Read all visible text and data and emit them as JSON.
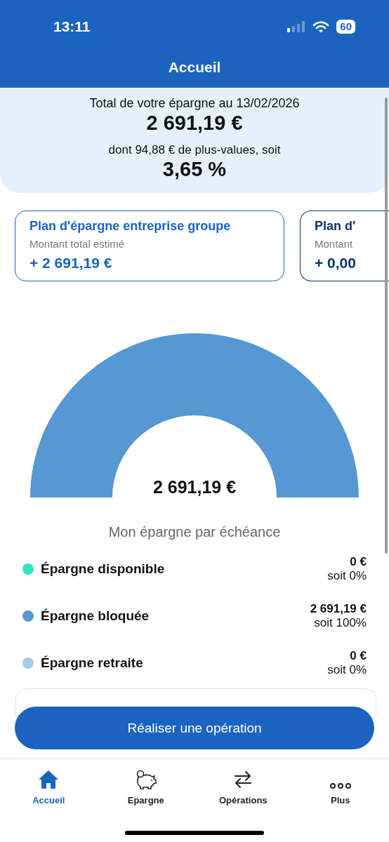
{
  "status_bar": {
    "time": "13:11",
    "battery": "60"
  },
  "header": {
    "title": "Accueil"
  },
  "summary": {
    "label": "Total de votre épargne au 13/02/2026",
    "total": "2 691,19 €",
    "gains_label": "dont 94,88 € de plus-values, soit",
    "gains_percent": "3,65 %"
  },
  "plans": [
    {
      "title": "Plan d'épargne entreprise groupe",
      "subtitle": "Montant total estimé",
      "amount": "+ 2 691,19 €",
      "clipped": false
    },
    {
      "title": "Plan d'",
      "subtitle": "Montant",
      "amount": "+ 0,00",
      "clipped": true
    }
  ],
  "gauge": {
    "center_value": "2 691,19 €",
    "caption": "Mon épargne par échéance"
  },
  "breakdown": [
    {
      "label": "Épargne disponible",
      "color": "#2ee6c0",
      "amount": "0 €",
      "share": "soit 0%"
    },
    {
      "label": "Épargne bloquée",
      "color": "#5598d4",
      "amount": "2 691,19 €",
      "share": "soit 100%"
    },
    {
      "label": "Épargne retraite",
      "color": "#a9cbeb",
      "amount": "0 €",
      "share": "soit 0%"
    }
  ],
  "action_button": "Réaliser une opération",
  "tabs": [
    {
      "label": "Accueil",
      "kind": "home",
      "selected": true
    },
    {
      "label": "Epargne",
      "kind": "piggy",
      "selected": false
    },
    {
      "label": "Opérations",
      "kind": "arrows",
      "selected": false
    },
    {
      "label": "Plus",
      "kind": "dots",
      "selected": false
    }
  ]
}
